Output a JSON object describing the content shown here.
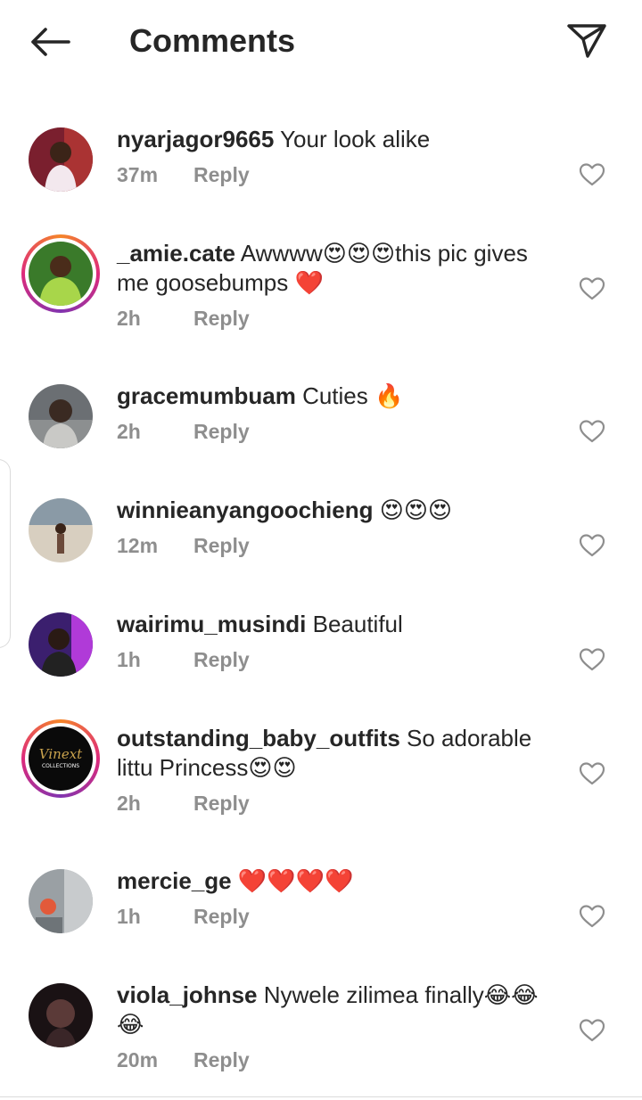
{
  "header": {
    "title": "Comments",
    "back_icon": "arrow-left-icon",
    "share_icon": "paper-plane-icon"
  },
  "colors": {
    "text": "#262626",
    "muted": "#8e8e8e",
    "heart_heart": "#e0245e",
    "story_ring": [
      "#f58529",
      "#dd2a7b",
      "#8134af"
    ]
  },
  "comments": [
    {
      "user": "nyarjagor9665",
      "text": " Your look alike",
      "time": "37m",
      "reply": "Reply",
      "ring": false,
      "avatar_colors": [
        "#7a1f2e",
        "#f3e8ee"
      ]
    },
    {
      "user": "_amie.cate",
      "text": " Awwww😍😍😍this pic gives me goosebumps ❤️",
      "time": "2h",
      "reply": "Reply",
      "ring": true,
      "avatar_colors": [
        "#3a7a2a",
        "#a8d64a"
      ]
    },
    {
      "user": "gracemumbuam",
      "text": " Cuties 🔥",
      "time": "2h",
      "reply": "Reply",
      "ring": false,
      "avatar_colors": [
        "#6b6f73",
        "#c9c9c6"
      ]
    },
    {
      "user": "winnieanyangoochieng",
      "text": " 😍😍😍",
      "time": "12m",
      "reply": "Reply",
      "ring": false,
      "avatar_colors": [
        "#8a9aa6",
        "#d8cfc0"
      ]
    },
    {
      "user": "wairimu_musindi",
      "text": " Beautiful",
      "time": "1h",
      "reply": "Reply",
      "ring": false,
      "avatar_colors": [
        "#3b1f6e",
        "#b03ad8"
      ]
    },
    {
      "user": "outstanding_baby_outfits",
      "text": " So adorable littu Princess😍😍",
      "time": "2h",
      "reply": "Reply",
      "ring": true,
      "avatar_colors": [
        "#0a0a0a",
        "#c9a24d"
      ],
      "avatar_text": "Vinext COLLECTIONS"
    },
    {
      "user": "mercie_ge",
      "text": " ❤️❤️❤️❤️",
      "time": "1h",
      "reply": "Reply",
      "ring": false,
      "avatar_colors": [
        "#9aa0a4",
        "#e25a3a"
      ]
    },
    {
      "user": "viola_johnse",
      "text": " Nywele zilimea finally😂😂😂",
      "time": "20m",
      "reply": "Reply",
      "ring": false,
      "avatar_colors": [
        "#1a1214",
        "#5b3a38"
      ]
    }
  ]
}
